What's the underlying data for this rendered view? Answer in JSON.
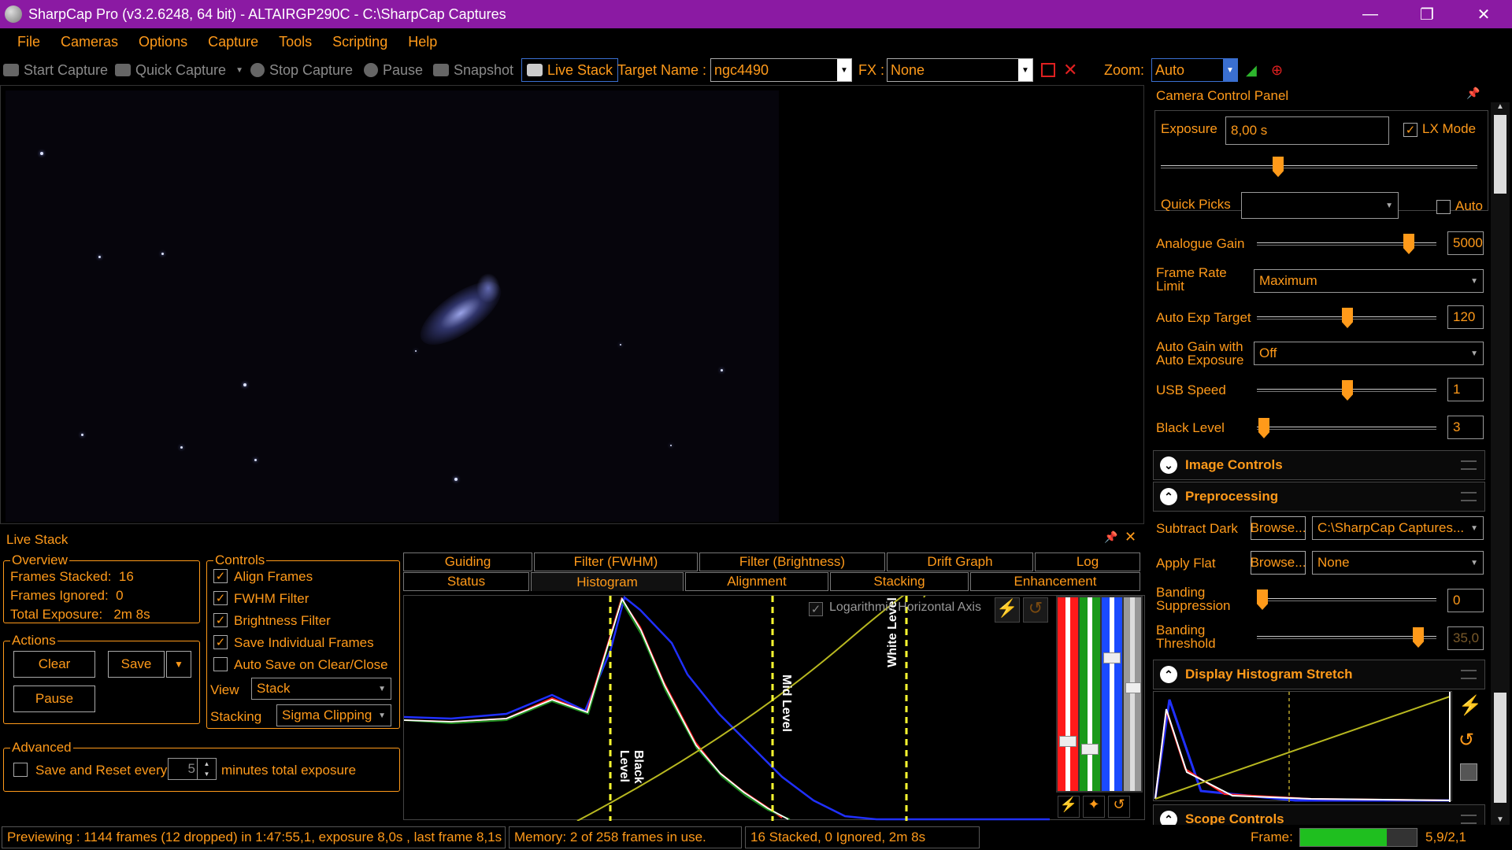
{
  "window": {
    "title": "SharpCap Pro (v3.2.6248, 64 bit) - ALTAIRGP290C - C:\\SharpCap Captures",
    "minimize": "—",
    "maximize": "❐",
    "close": "✕"
  },
  "menu": [
    "File",
    "Cameras",
    "Options",
    "Capture",
    "Tools",
    "Scripting",
    "Help"
  ],
  "toolbar": {
    "start_capture": "Start Capture",
    "quick_capture": "Quick Capture",
    "stop_capture": "Stop Capture",
    "pause": "Pause",
    "snapshot": "Snapshot",
    "live_stack": "Live Stack",
    "target_name_label": "Target Name :",
    "target_name_value": "ngc4490",
    "fx_label": "FX :",
    "fx_value": "None",
    "zoom_label": "Zoom:",
    "zoom_value": "Auto"
  },
  "camera_panel": {
    "title": "Camera Control Panel",
    "exposure_label": "Exposure",
    "exposure_value": "8,00 s",
    "lx_mode": "LX Mode",
    "lx_checked": true,
    "quick_picks": "Quick Picks",
    "auto": "Auto",
    "analogue_gain_label": "Analogue Gain",
    "analogue_gain_value": "5000",
    "frame_rate_label": "Frame Rate Limit",
    "frame_rate_value": "Maximum",
    "auto_exp_target_label": "Auto Exp Target",
    "auto_exp_target_value": "120",
    "auto_gain_label": "Auto Gain with Auto Exposure",
    "auto_gain_value": "Off",
    "usb_speed_label": "USB Speed",
    "usb_speed_value": "1",
    "black_level_label": "Black Level",
    "black_level_value": "3",
    "image_controls": "Image Controls",
    "preprocessing": "Preprocessing",
    "subtract_dark_label": "Subtract Dark",
    "browse": "Browse...",
    "subtract_dark_value": "C:\\SharpCap Captures...",
    "apply_flat_label": "Apply Flat",
    "apply_flat_value": "None",
    "banding_suppression_label": "Banding Suppression",
    "banding_suppression_value": "0",
    "banding_threshold_label": "Banding Threshold",
    "banding_threshold_value": "35,0",
    "display_histogram_stretch": "Display Histogram Stretch",
    "scope_controls": "Scope Controls"
  },
  "live_stack": {
    "title": "Live Stack",
    "overview_caption": "Overview",
    "frames_stacked": "Frames Stacked:  16",
    "frames_ignored": "Frames Ignored:  0",
    "total_exposure": "Total Exposure:   2m 8s",
    "actions_caption": "Actions",
    "clear": "Clear",
    "save": "Save",
    "pause": "Pause",
    "controls_caption": "Controls",
    "align_frames": "Align Frames",
    "fwhm_filter": "FWHM Filter",
    "brightness_filter": "Brightness Filter",
    "save_individual": "Save Individual Frames",
    "auto_save": "Auto Save on Clear/Close",
    "view_label": "View",
    "view_value": "Stack",
    "stacking_label": "Stacking",
    "stacking_value": "Sigma Clipping",
    "advanced_caption": "Advanced",
    "save_reset": "Save and Reset every",
    "minutes_value": "5",
    "minutes_label": "minutes total exposure",
    "tabs_top": [
      "Guiding",
      "Filter (FWHM)",
      "Filter (Brightness)",
      "Drift Graph",
      "Log"
    ],
    "tabs_bottom": [
      "Status",
      "Histogram",
      "Alignment",
      "Stacking",
      "Enhancement"
    ],
    "log_axis": "Logarithmic Horizontal Axis",
    "black_level_marker": "Black Level",
    "mid_level_marker": "Mid Level",
    "white_level_marker": "White Level"
  },
  "status": {
    "previewing": "Previewing : 1144 frames (12 dropped) in 1:47:55,1, exposure 8,0s , last frame 8,1s",
    "memory": "Memory: 2 of 258 frames in use.",
    "stacked": "16 Stacked, 0 Ignored, 2m 8s",
    "frame_label": "Frame:",
    "frame_value": "5,9/2,1"
  }
}
